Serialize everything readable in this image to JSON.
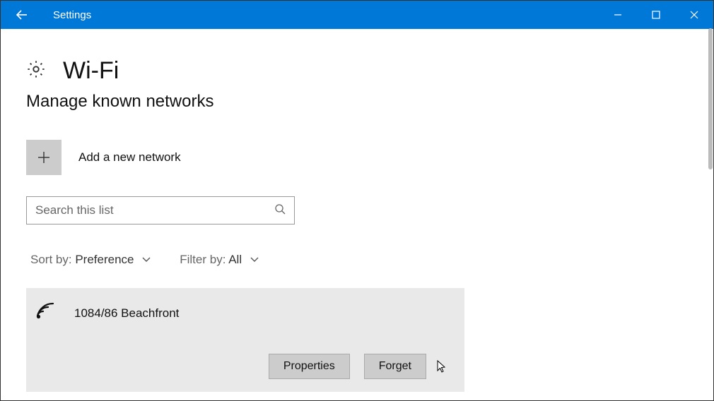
{
  "titlebar": {
    "title": "Settings"
  },
  "page": {
    "heading": "Wi-Fi",
    "subheading": "Manage known networks",
    "add_label": "Add a new network",
    "search_placeholder": "Search this list",
    "sort_label": "Sort by:",
    "sort_value": "Preference",
    "filter_label": "Filter by:",
    "filter_value": "All"
  },
  "network": {
    "name": "1084/86 Beachfront",
    "properties_label": "Properties",
    "forget_label": "Forget"
  }
}
